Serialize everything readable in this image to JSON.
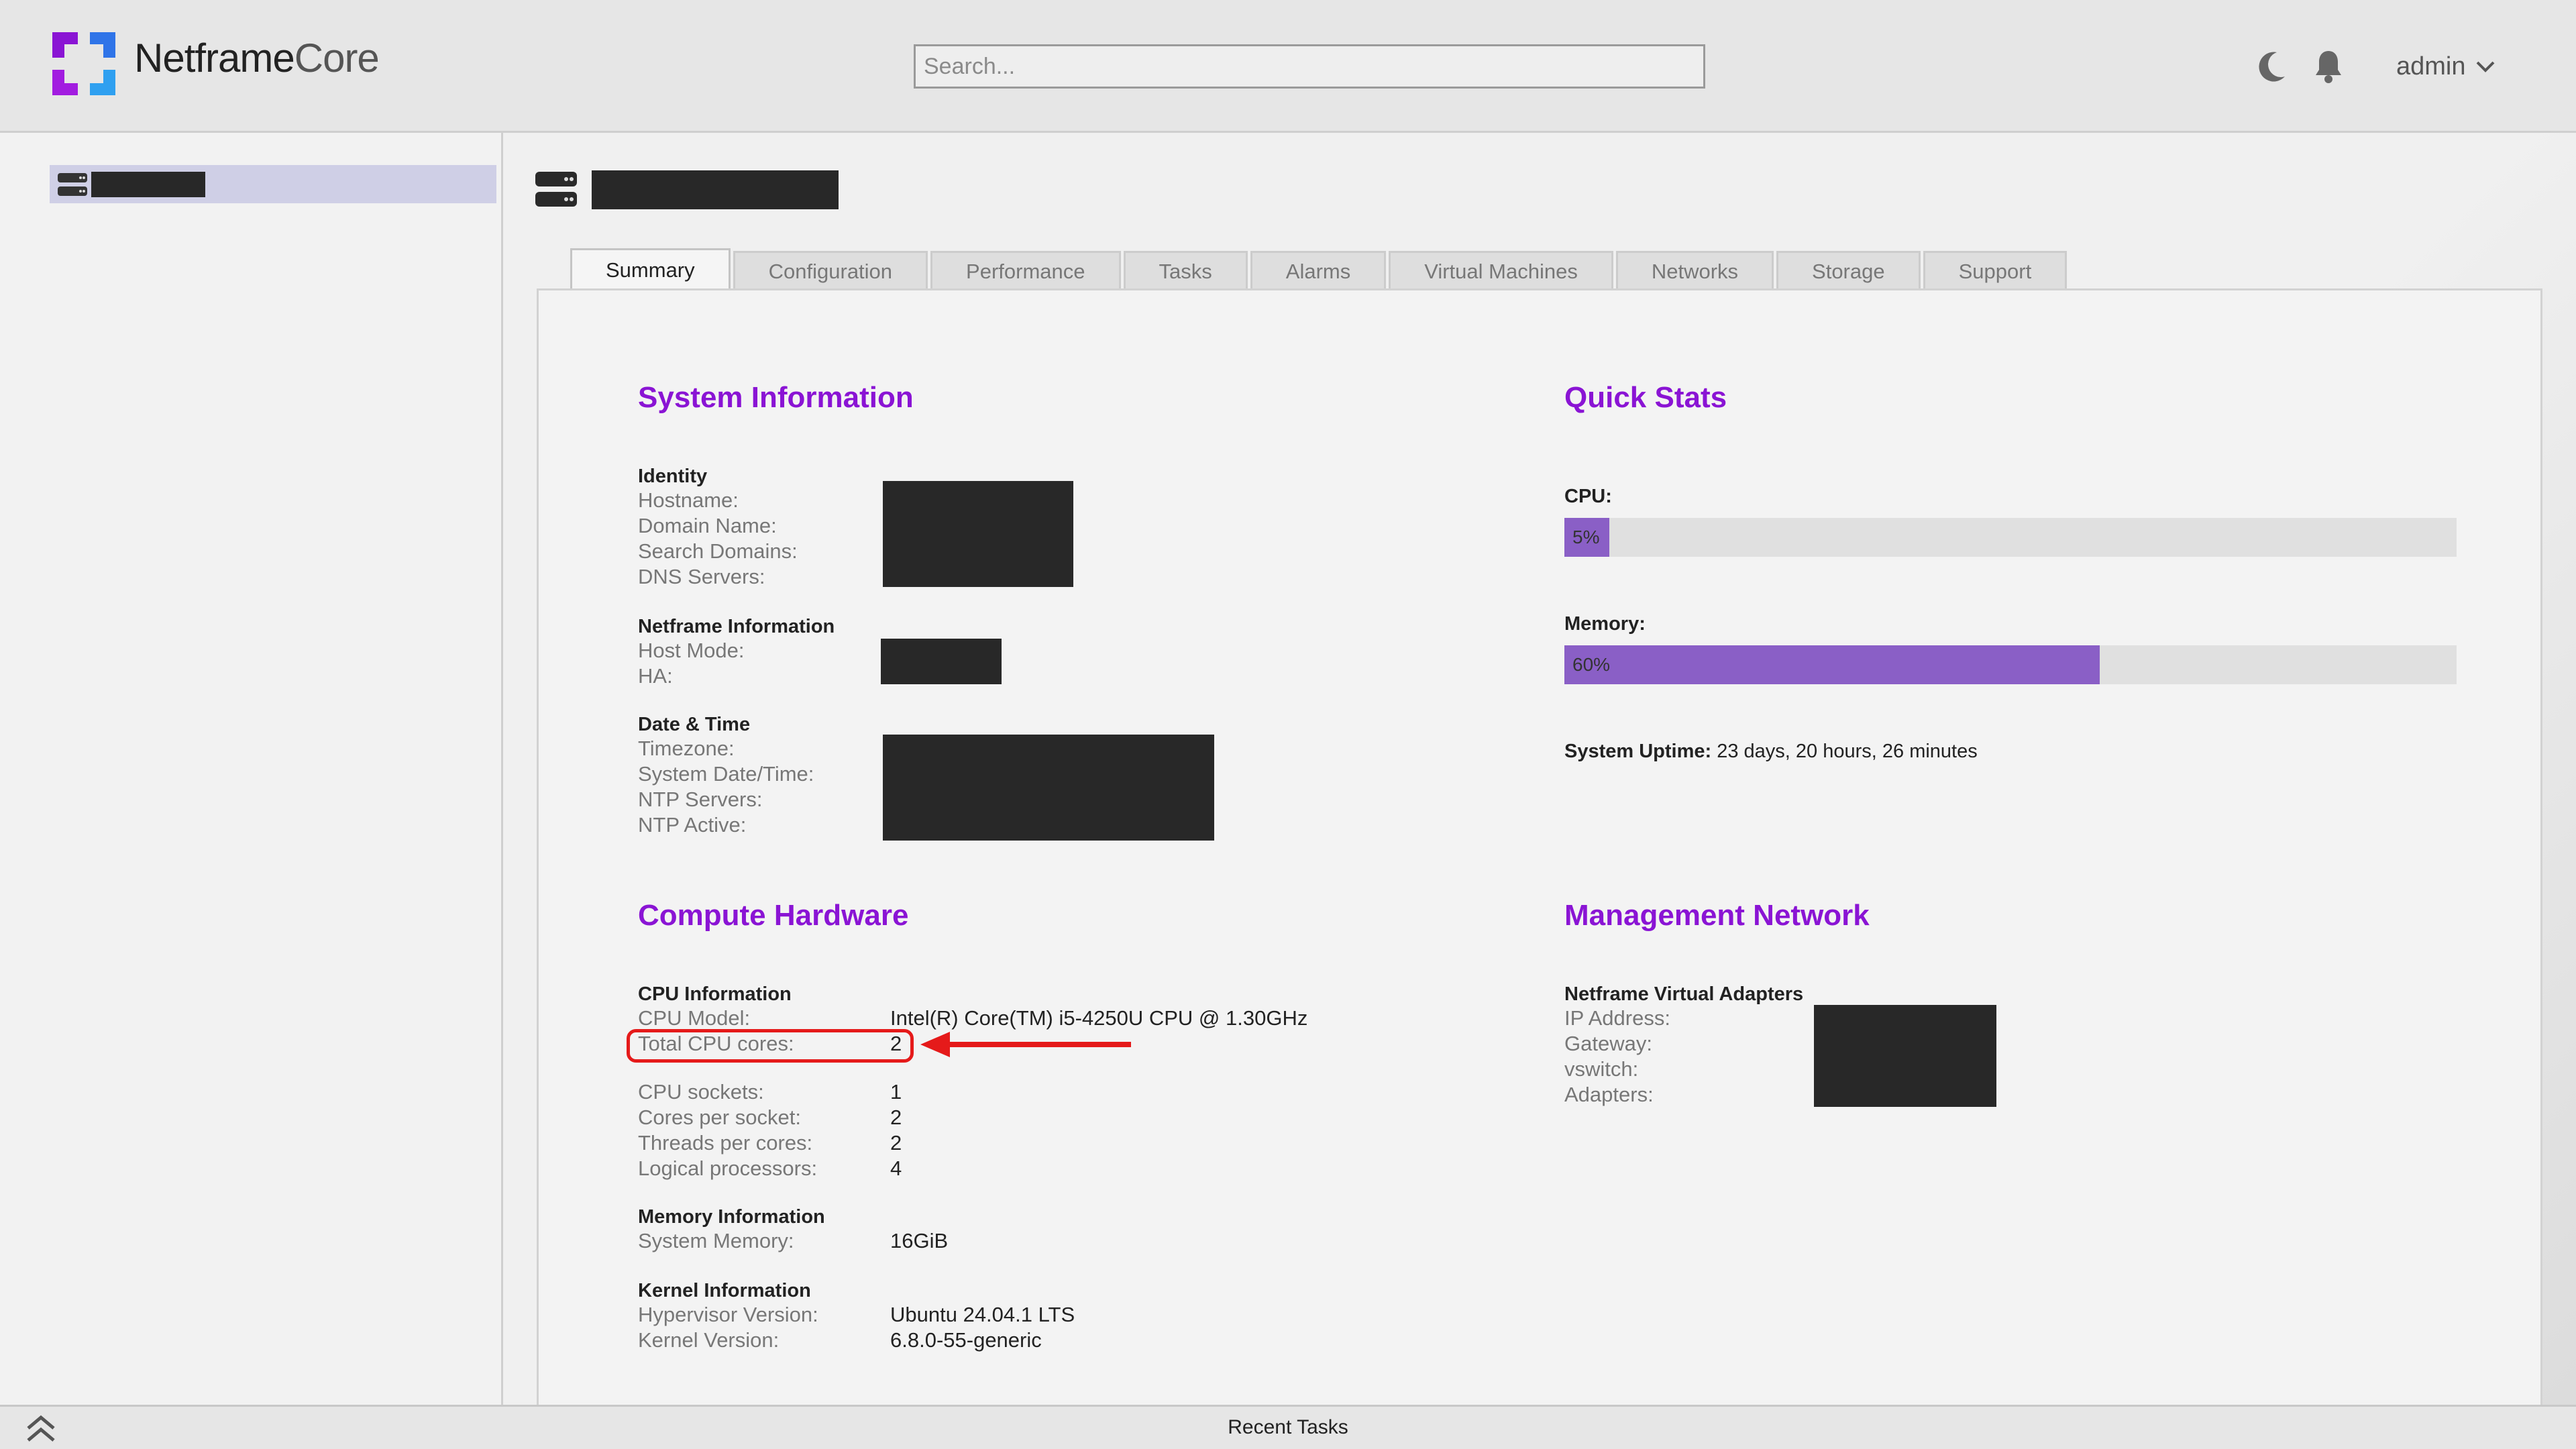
{
  "app": {
    "brand_main": "Netframe",
    "brand_accent": "Core",
    "accent_color": "#8a14d4"
  },
  "header": {
    "search_placeholder": "Search...",
    "theme_icon": "moon-icon",
    "notifications_icon": "bell-icon",
    "user": "admin"
  },
  "tabs": [
    "Summary",
    "Configuration",
    "Performance",
    "Tasks",
    "Alarms",
    "Virtual Machines",
    "Networks",
    "Storage",
    "Support"
  ],
  "system_info": {
    "title": "System Information",
    "identity": {
      "title": "Identity",
      "labels": [
        "Hostname:",
        "Domain Name:",
        "Search Domains:",
        "DNS Servers:"
      ]
    },
    "netframe": {
      "title": "Netframe Information",
      "labels": [
        "Host Mode:",
        "HA:"
      ]
    },
    "datetime": {
      "title": "Date & Time",
      "labels": [
        "Timezone:",
        "System Date/Time:",
        "NTP Servers:",
        "NTP Active:"
      ]
    }
  },
  "quick_stats": {
    "title": "Quick Stats",
    "cpu_label": "CPU:",
    "cpu_percent": 5,
    "cpu_text": "5%",
    "memory_label": "Memory:",
    "memory_percent": 60,
    "memory_text": "60%",
    "uptime_label": "System Uptime:",
    "uptime_value": "23 days, 20 hours, 26 minutes"
  },
  "compute": {
    "title": "Compute Hardware",
    "cpu_title": "CPU Information",
    "cpu_model_label": "CPU Model:",
    "cpu_model": "Intel(R) Core(TM) i5-4250U CPU @ 1.30GHz",
    "total_cores_label": "Total CPU cores:",
    "total_cores": "2",
    "sockets_label": "CPU sockets:",
    "sockets": "1",
    "cores_per_socket_label": "Cores per socket:",
    "cores_per_socket": "2",
    "threads_label": "Threads per cores:",
    "threads": "2",
    "logical_label": "Logical processors:",
    "logical": "4",
    "memory_title": "Memory Information",
    "system_memory_label": "System Memory:",
    "system_memory": "16GiB",
    "kernel_title": "Kernel Information",
    "hypervisor_label": "Hypervisor Version:",
    "hypervisor": "Ubuntu 24.04.1 LTS",
    "kernel_label": "Kernel Version:",
    "kernel": "6.8.0-55-generic"
  },
  "mgmt": {
    "title": "Management Network",
    "adapters_title": "Netframe Virtual Adapters",
    "labels": [
      "IP Address:",
      "Gateway:",
      "vswitch:",
      "Adapters:"
    ]
  },
  "footer": {
    "recent_tasks": "Recent Tasks"
  }
}
